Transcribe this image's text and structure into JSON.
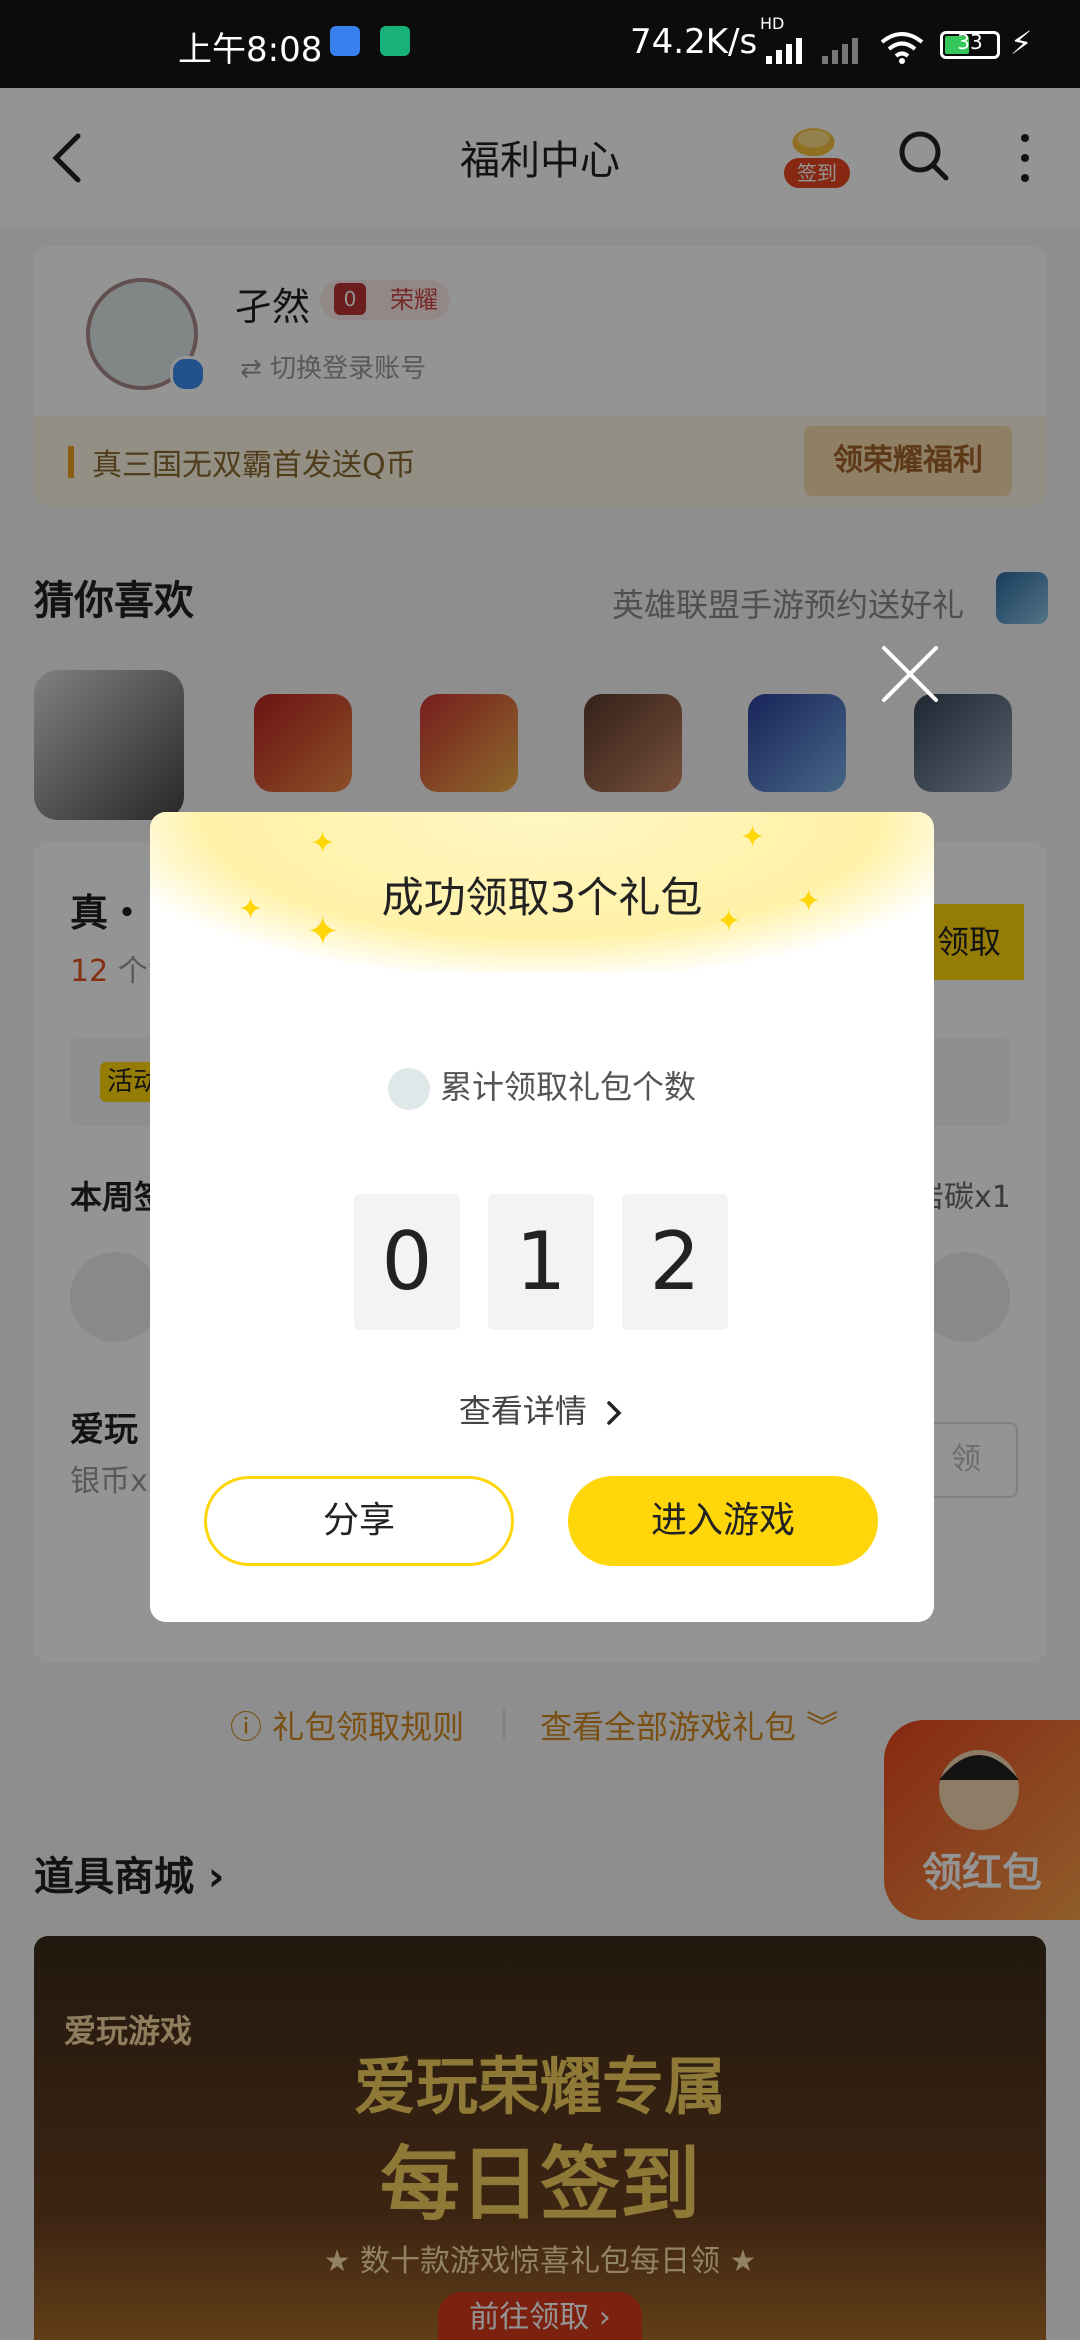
{
  "status_bar": {
    "time": "上午8:08",
    "speed": "74.2K/s",
    "network_tag": "HD",
    "battery": "33"
  },
  "header": {
    "title": "福利中心",
    "sign_badge": "签到"
  },
  "user": {
    "name": "孑然",
    "level_num": "0",
    "level_label": "荣耀",
    "switch_label": "切换登录账号",
    "promo_text": "真三国无双霸首发送Q币",
    "promo_button": "领荣耀福利"
  },
  "recommend": {
    "title": "猜你喜欢",
    "link": "英雄联盟手游预约送好礼"
  },
  "game_card": {
    "title": "真・",
    "sub_num": "12",
    "sub_text": "个免",
    "claim_label": "领取",
    "activity_tag": "活动",
    "week_label": "本周签",
    "week_right": "岩碳x1",
    "aw_label": "爱玩",
    "coin_label": "银币x",
    "btn_label": "领"
  },
  "rules": {
    "left": "ⓘ 礼包领取规则",
    "right": "查看全部游戏礼包 ︾"
  },
  "shop": {
    "title": "道具商城 ›"
  },
  "redpacket": {
    "label": "领红包"
  },
  "banner": {
    "brand": "爱玩游戏",
    "line1": "爱玩荣耀专属",
    "line2": "每日签到",
    "line3": "★ 数十款游戏惊喜礼包每日领 ★",
    "cta": "前往领取 ›"
  },
  "modal": {
    "title": "成功领取3个礼包",
    "count_label": "累计领取礼包个数",
    "digits": [
      "0",
      "1",
      "2"
    ],
    "detail_label": "查看详情",
    "share_label": "分享",
    "enter_label": "进入游戏"
  }
}
